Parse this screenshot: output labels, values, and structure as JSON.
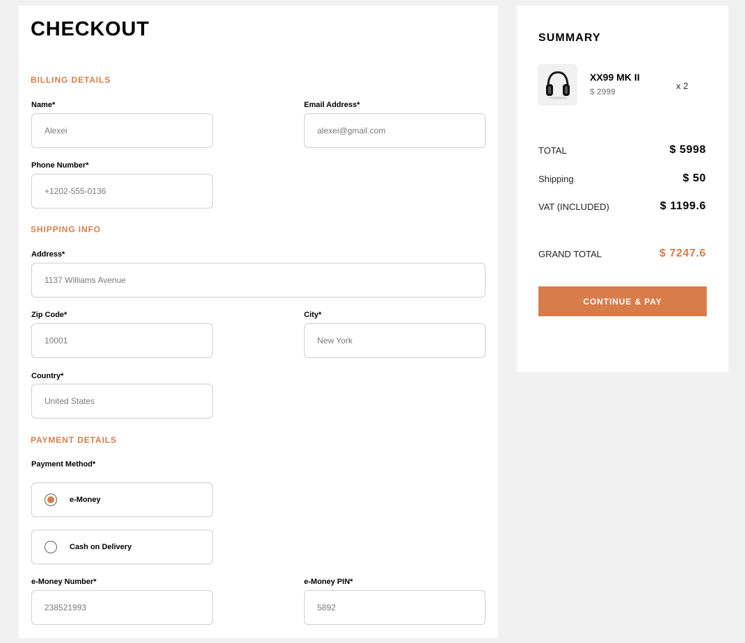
{
  "checkout": {
    "title": "CHECKOUT",
    "billing": {
      "title": "BILLING DETAILS",
      "name_label": "Name*",
      "name_value": "Alexei",
      "email_label": "Email Address*",
      "email_value": "alexei@gmail.com",
      "phone_label": "Phone Number*",
      "phone_value": "+1202-555-0136"
    },
    "shipping": {
      "title": "SHIPPING INFO",
      "address_label": "Address*",
      "address_value": "1137 Williams Avenue",
      "zip_label": "Zip Code*",
      "zip_value": "10001",
      "city_label": "City*",
      "city_value": "New York",
      "country_label": "Country*",
      "country_value": "United States"
    },
    "payment": {
      "title": "PAYMENT DETAILS",
      "method_label": "Payment Method*",
      "options": [
        {
          "label": "e-Money",
          "selected": true
        },
        {
          "label": "Cash on Delivery",
          "selected": false
        }
      ],
      "emoney_number_label": "e-Money Number*",
      "emoney_number_value": "238521993",
      "emoney_pin_label": "e-Money PIN*",
      "emoney_pin_value": "5892"
    }
  },
  "summary": {
    "title": "SUMMARY",
    "item": {
      "name": "XX99 MK II",
      "price": "$ 2999",
      "qty": "x 2",
      "icon": "headphones-icon"
    },
    "total_label": "TOTAL",
    "total_value": "$ 5998",
    "shipping_label": "Shipping",
    "shipping_value": "$ 50",
    "vat_label": "VAT (INCLUDED)",
    "vat_value": "$ 1199.6",
    "grand_label": "GRAND TOTAL",
    "grand_value": "$ 7247.6",
    "pay_button": "CONTINUE & PAY"
  },
  "colors": {
    "accent": "#d87d4a",
    "background": "#f1f1f1"
  }
}
